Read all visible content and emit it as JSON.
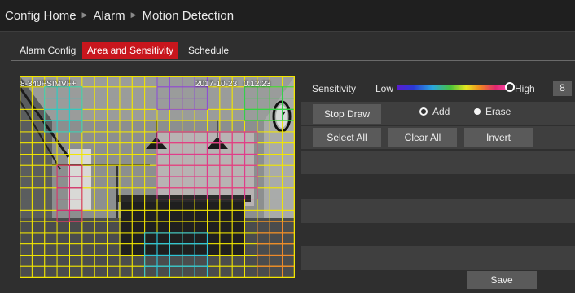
{
  "breadcrumb": [
    "Config Home",
    "Alarm",
    "Motion Detection"
  ],
  "tabs": [
    "Alarm Config",
    "Area and Sensitivity",
    "Schedule"
  ],
  "active_tab": "Area and Sensitivity",
  "video": {
    "osd_camera": "8-340PSIMVF+",
    "osd_date": "2017-10-23",
    "osd_time": "0:12:23",
    "grid_color": "#f2e600"
  },
  "sensitivity": {
    "label": "Sensitivity",
    "low": "Low",
    "high": "High",
    "value": "8"
  },
  "controls": {
    "stop_draw": "Stop Draw",
    "add": "Add",
    "erase": "Erase",
    "select_all": "Select All",
    "clear_all": "Clear All",
    "invert": "Invert",
    "save": "Save"
  }
}
